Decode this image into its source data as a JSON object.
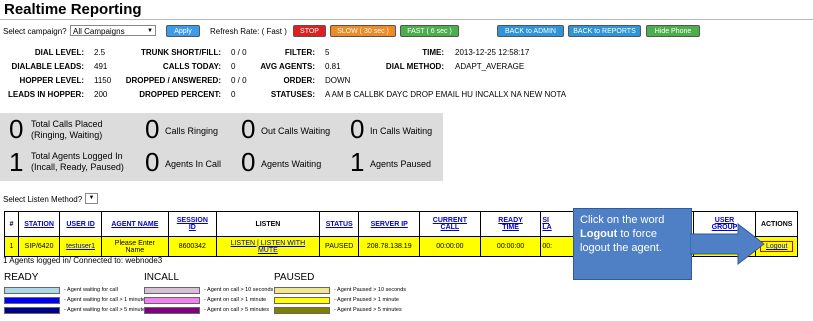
{
  "header": {
    "title": "Realtime Reporting"
  },
  "controls": {
    "campaign_label": "Select campaign?",
    "campaign_value": "All Campaigns",
    "apply": "Apply",
    "refresh_label": "Refresh Rate: ( Fast )",
    "stop": "STOP",
    "slow": "SLOW ( 30 sec )",
    "fast": "FAST ( 6 sec )",
    "back_admin": "BACK to ADMIN",
    "back_reports": "BACK to REPORTS",
    "hide_phone": "Hide Phone"
  },
  "stats": {
    "col1": [
      {
        "l": "DIAL LEVEL:",
        "v": "2.5"
      },
      {
        "l": "DIALABLE LEADS:",
        "v": "491"
      },
      {
        "l": "HOPPER LEVEL:",
        "v": "1150"
      },
      {
        "l": "LEADS IN HOPPER:",
        "v": "200"
      }
    ],
    "col2": [
      {
        "l": "TRUNK SHORT/FILL:",
        "v": "0 / 0"
      },
      {
        "l": "CALLS TODAY:",
        "v": "0"
      },
      {
        "l": "DROPPED / ANSWERED:",
        "v": "0 / 0"
      },
      {
        "l": "DROPPED PERCENT:",
        "v": "0"
      }
    ],
    "col3": [
      {
        "l": "FILTER:",
        "v": "5"
      },
      {
        "l": "AVG AGENTS:",
        "v": "0.81"
      },
      {
        "l": "ORDER:",
        "v": "DOWN"
      },
      {
        "l": "STATUSES:",
        "v": "A AM B CALLBK DAYC DROP EMAIL HU INCALLX NA NEW NOTA"
      }
    ],
    "col4": [
      {
        "l": "TIME:",
        "v": "2013-12-25 12:58:17"
      },
      {
        "l": "DIAL METHOD:",
        "v": "ADAPT_AVERAGE"
      }
    ]
  },
  "summary": {
    "calls_placed": {
      "n": "0",
      "t1": "Total Calls Placed",
      "t2": "(Ringing, Waiting)"
    },
    "calls_ringing": {
      "n": "0",
      "t": "Calls Ringing"
    },
    "out_waiting": {
      "n": "0",
      "t": "Out Calls Waiting"
    },
    "in_waiting": {
      "n": "0",
      "t": "In Calls Waiting"
    },
    "agents_logged": {
      "n": "1",
      "t1": "Total Agents Logged In",
      "t2": "(Incall, Ready, Paused)"
    },
    "agents_incall": {
      "n": "0",
      "t": "Agents In Call"
    },
    "agents_waiting": {
      "n": "0",
      "t": "Agents Waiting"
    },
    "agents_paused": {
      "n": "1",
      "t": "Agents Paused"
    }
  },
  "listen": {
    "label": "Select Listen Method?"
  },
  "table": {
    "headers": {
      "num": "#",
      "station": "STATION",
      "user_id": "USER ID",
      "agent_name": "AGENT NAME",
      "session_1": "SESSION",
      "session_2": "ID",
      "listen": "LISTEN",
      "status": "STATUS",
      "server_ip": "SERVER IP",
      "current_1": "CURRENT",
      "current_2": "CALL",
      "ready_1": "READY",
      "ready_2": "TIME",
      "since_1": "SI",
      "since_2": "LA",
      "user_group_1": "USER",
      "user_group_2": "GROUP",
      "actions": "ACTIONS"
    },
    "row": {
      "num": "1",
      "station": "SIP/6420",
      "user_id": "testuser1",
      "agent_1": "Please Enter",
      "agent_2": "Name",
      "session": "8600342",
      "listen_1": "LISTEN | LISTEN WITH",
      "listen_2": "MUTE",
      "status": "PAUSED",
      "server_ip": "208.78.138.19",
      "current": "00:00:00",
      "ready": "00:00:00",
      "since": "00:",
      "logout": "Logout"
    }
  },
  "footer": {
    "agents_text": "1 Agents logged in/ Connected to: webnode3"
  },
  "legend": {
    "ready": {
      "title": "READY",
      "items": [
        "- Agent waiting for call",
        "- Agent waiting for call > 1 minute",
        "- Agent waiting for call > 5 minutes"
      ],
      "colors": [
        "#add8e6",
        "#0000ff",
        "#00008b"
      ]
    },
    "incall": {
      "title": "INCALL",
      "items": [
        "- Agent on call > 10 seconds",
        "- Agent on call > 1 minute",
        "- Agent on call > 5 minutes"
      ],
      "colors": [
        "#d8bfd8",
        "#ee82ee",
        "#800080"
      ]
    },
    "paused": {
      "title": "PAUSED",
      "items": [
        "- Agent Paused > 10 seconds",
        "- Agent Paused > 1 minute",
        "- Agent Paused > 5 minutes"
      ],
      "colors": [
        "#f0e68c",
        "#ffff00",
        "#808000"
      ]
    }
  },
  "callout": {
    "l1": "Click on the word",
    "bold": "Logout",
    "l2": " to force",
    "l3": "logout the agent."
  }
}
